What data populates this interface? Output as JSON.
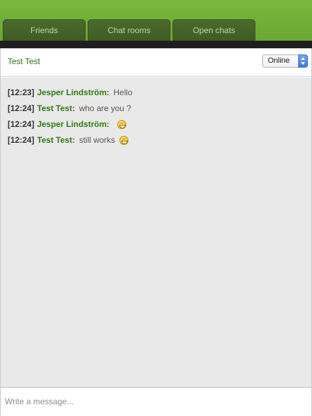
{
  "tabs": [
    {
      "label": "Friends"
    },
    {
      "label": "Chat rooms"
    },
    {
      "label": "Open chats"
    }
  ],
  "chat": {
    "title": "Test Test",
    "status": "Online"
  },
  "messages": [
    {
      "time": "[12:23]",
      "user": "Jesper Lindström:",
      "text": "Hello",
      "emoji": ""
    },
    {
      "time": "[12:24]",
      "user": "Test Test:",
      "text": "who are you ?",
      "emoji": ""
    },
    {
      "time": "[12:24]",
      "user": "Jesper Lindström:",
      "text": "",
      "emoji": "smiley-icon"
    },
    {
      "time": "[12:24]",
      "user": "Test Test:",
      "text": "still works",
      "emoji": "smiley-icon"
    }
  ],
  "composer": {
    "placeholder": "Write a message..."
  },
  "colors": {
    "accent_green": "#6aa535",
    "username_green": "#2f7a12"
  }
}
